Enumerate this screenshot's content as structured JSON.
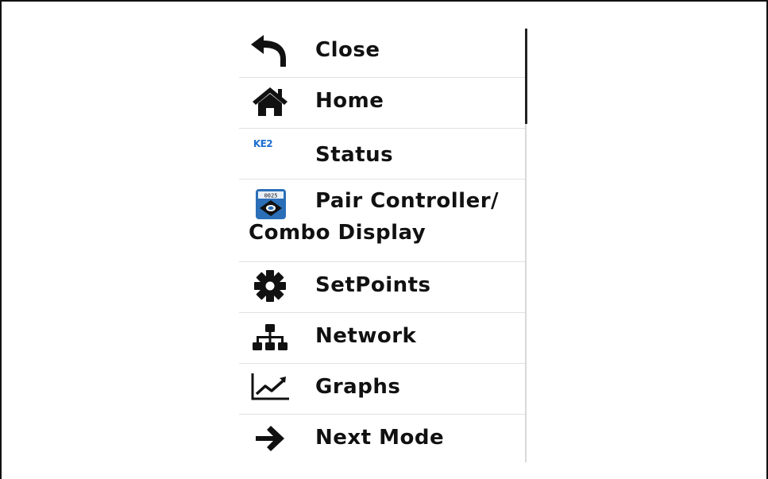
{
  "menu": {
    "items": [
      {
        "label": "Close",
        "icon": "undo-arrow-icon"
      },
      {
        "label": "Home",
        "icon": "home-icon"
      },
      {
        "label": "Status",
        "icon": "ke2-logo-icon",
        "logo_text": "KE2"
      },
      {
        "label": "Pair Controller/",
        "label_line2": "Combo Display",
        "icon": "controller-display-icon",
        "display_text": "0025"
      },
      {
        "label": "SetPoints",
        "icon": "gear-icon"
      },
      {
        "label": "Network",
        "icon": "network-icon"
      },
      {
        "label": "Graphs",
        "icon": "line-chart-icon"
      },
      {
        "label": "Next Mode",
        "icon": "arrow-right-icon"
      }
    ]
  },
  "colors": {
    "text": "#111111",
    "divider": "#e1e1e1",
    "ke2_blue": "#1f6fd1",
    "controller_blue": "#2a6fb8"
  }
}
